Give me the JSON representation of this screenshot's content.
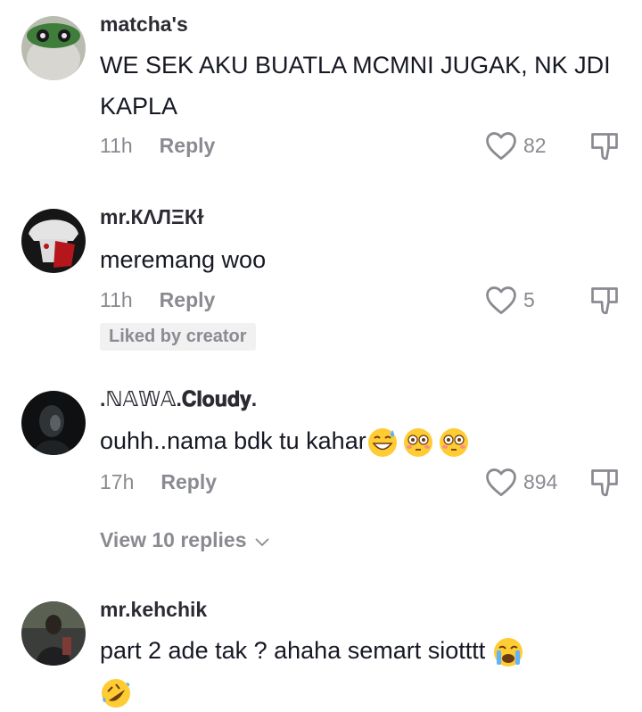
{
  "comments": [
    {
      "username": "matcha's",
      "text": "WE SEK AKU BUATLA MCMNI JUGAK, NK JDI KAPLA",
      "time": "11h",
      "reply_label": "Reply",
      "likes": "82"
    },
    {
      "username": "mr.КΛЛΞКɫ",
      "text": "meremang woo",
      "time": "11h",
      "reply_label": "Reply",
      "likes": "5",
      "badge": "Liked by creator"
    },
    {
      "username": ".ℕ𝔸𝕎𝔸.𝐂𝐥𝐨𝐮𝐝𝐲.",
      "text": "ouhh..nama bdk tu kahar",
      "emojis": [
        "grinning-sweat-emoji",
        "flushed-emoji",
        "flushed-emoji"
      ],
      "time": "17h",
      "reply_label": "Reply",
      "likes": "894",
      "view_replies": "View 10 replies"
    },
    {
      "username": "mr.kehchik",
      "text": "part 2 ade tak ? ahaha semart siotttt",
      "emojis": [
        "crying-emoji",
        "rolling-laugh-emoji"
      ]
    }
  ],
  "colors": {
    "text": "#161823",
    "secondary": "#8a8b91",
    "emoji": "#ffcc33"
  }
}
